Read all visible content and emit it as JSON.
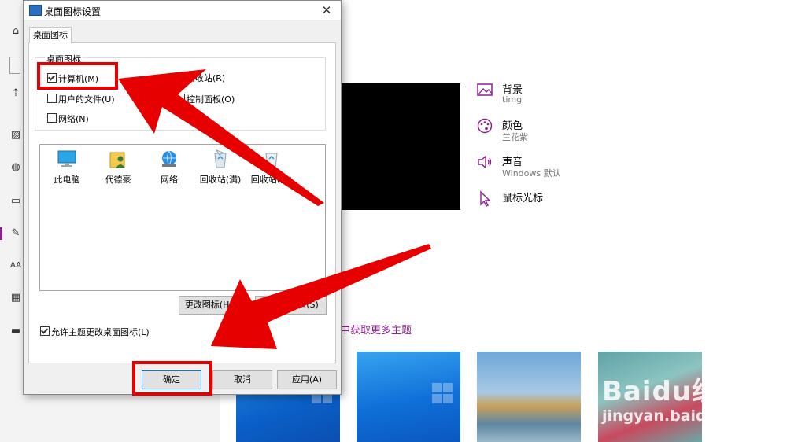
{
  "dialog": {
    "title": "桌面图标设置",
    "tab_label": "桌面图标",
    "group_label": "桌面图标",
    "checkboxes": [
      {
        "label": "计算机(M)",
        "checked": true
      },
      {
        "label": "回收站(R)",
        "checked": true
      },
      {
        "label": "用户的文件(U)",
        "checked": false
      },
      {
        "label": "控制面板(O)",
        "checked": false
      },
      {
        "label": "网络(N)",
        "checked": false
      }
    ],
    "icons": [
      {
        "label": "此电脑",
        "icon": "computer-icon"
      },
      {
        "label": "代德豪",
        "icon": "user-folder-icon"
      },
      {
        "label": "网络",
        "icon": "network-icon"
      },
      {
        "label": "回收站(满)",
        "icon": "recycle-bin-full-icon"
      },
      {
        "label": "回收站(空)",
        "icon": "recycle-bin-empty-icon"
      }
    ],
    "change_icon_button": "更改图标(H)...",
    "restore_default_button": "还原默认值(S)",
    "allow_theme_label": "允许主题更改桌面图标(L)",
    "allow_theme_checked": true,
    "ok_button": "确定",
    "cancel_button": "取消",
    "apply_button": "应用(A)"
  },
  "settings": {
    "items": [
      {
        "title": "背景",
        "subtitle": "timg",
        "icon": "image-icon"
      },
      {
        "title": "颜色",
        "subtitle": "兰花紫",
        "icon": "palette-icon"
      },
      {
        "title": "声音",
        "subtitle": "Windows 默认",
        "icon": "speaker-icon"
      },
      {
        "title": "鼠标光标",
        "subtitle": "",
        "icon": "cursor-icon"
      }
    ],
    "get_more_themes_link": "中获取更多主题"
  },
  "watermark": {
    "logo": "Baidu经验",
    "url": "jingyan.baidu.com"
  },
  "colors": {
    "accent": "#8a1f8d",
    "annotation_red": "#e60000"
  }
}
